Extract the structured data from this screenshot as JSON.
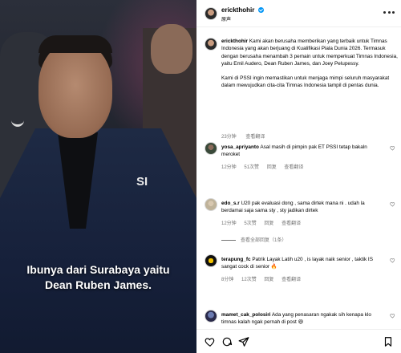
{
  "media": {
    "brand_mark": "SI",
    "subtitle_line1": "Ibunya dari Surabaya yaitu",
    "subtitle_line2": "Dean Ruben James."
  },
  "post": {
    "author": "erickthohir",
    "author_sub": "原声",
    "caption_user": "erickthohir",
    "caption_p1": "Kami akan berusaha memberikan yang terbaik untuk Timnas Indonesia yang akan berjuang di Kualifikasi Piala Dunia 2026. Termasuk dengan berusaha menambah 3 pemain untuk memperkuat Timnas Indonesia, yaitu Emil Audero, Dean Ruben James, dan Joey Pelupessy.",
    "caption_p2": "Kami di PSSI ingin memastikan untuk menjaga mimpi seluruh masyarakat dalam mewujudkan cita-cita Timnas Indonesia tampil di pentas dunia.",
    "time": "23分钟",
    "see_translation": "查看翻译"
  },
  "comments": [
    {
      "user": "yosa_apriyanto",
      "text": "Asal masih di pimpin pak ET PSSI tetap bakaln meroket",
      "time": "12分钟",
      "likes": "51次赞",
      "reply": "回复",
      "translate": "查看翻译"
    },
    {
      "user": "edo_s.r",
      "text": "U20 pak evaluasi dong , sama dirtek mana ni . udah la berdamai saja sama sty , sty jadikan dirtek",
      "time": "12分钟",
      "likes": "5次赞",
      "reply": "回复",
      "translate": "查看翻译",
      "replies": "查看全部回复（1条）"
    },
    {
      "user": "terapung_fc",
      "text": "Patrik Layak Latih u20 , is layak naik senior , taktik IS sangat cock di senior 🔥",
      "time": "8分钟",
      "likes": "12次赞",
      "reply": "回复",
      "translate": "查看翻译"
    },
    {
      "user": "mamet_cak_polosiri",
      "text": "Ada yang penasaran ngakak sih kenapa klo timnas kalah ngak pernah di post 😆"
    }
  ],
  "icons": {
    "more": "more-horizontal-icon",
    "heart": "heart-icon",
    "comment": "comment-icon",
    "share": "share-icon",
    "save": "bookmark-icon",
    "verified": "verified-badge-icon"
  },
  "colors": {
    "verified": "#0095f6",
    "muted": "#737373"
  }
}
